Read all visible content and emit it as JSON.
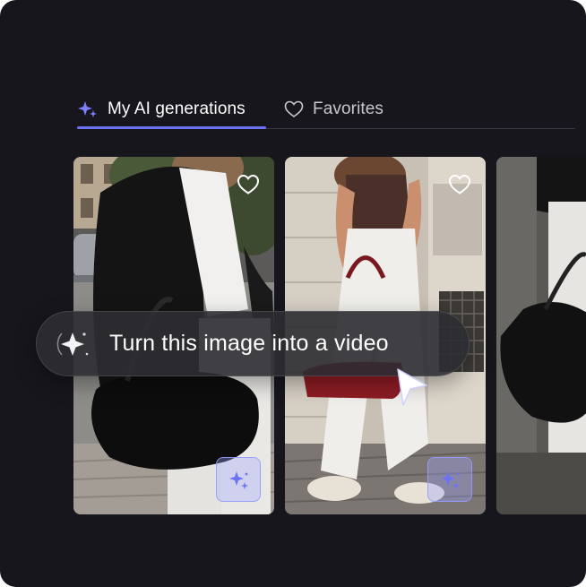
{
  "tabs": {
    "ai_generations": {
      "label": "My AI generations",
      "icon": "sparkle-icon",
      "active": true
    },
    "favorites": {
      "label": "Favorites",
      "icon": "heart-icon",
      "active": false
    }
  },
  "gallery": {
    "cards": [
      {
        "heart": "heart-icon",
        "action": "sparkle-icon"
      },
      {
        "heart": "heart-icon",
        "action": "sparkle-icon"
      },
      {
        "partial": true
      }
    ]
  },
  "tooltip": {
    "text": "Turn this image into a video",
    "icon": "sparkle-icon"
  },
  "colors": {
    "background": "#17161c",
    "accent": "#6d72f4",
    "tab_inactive": "#c9c8cf",
    "tooltip_bg": "#2c2c32"
  }
}
